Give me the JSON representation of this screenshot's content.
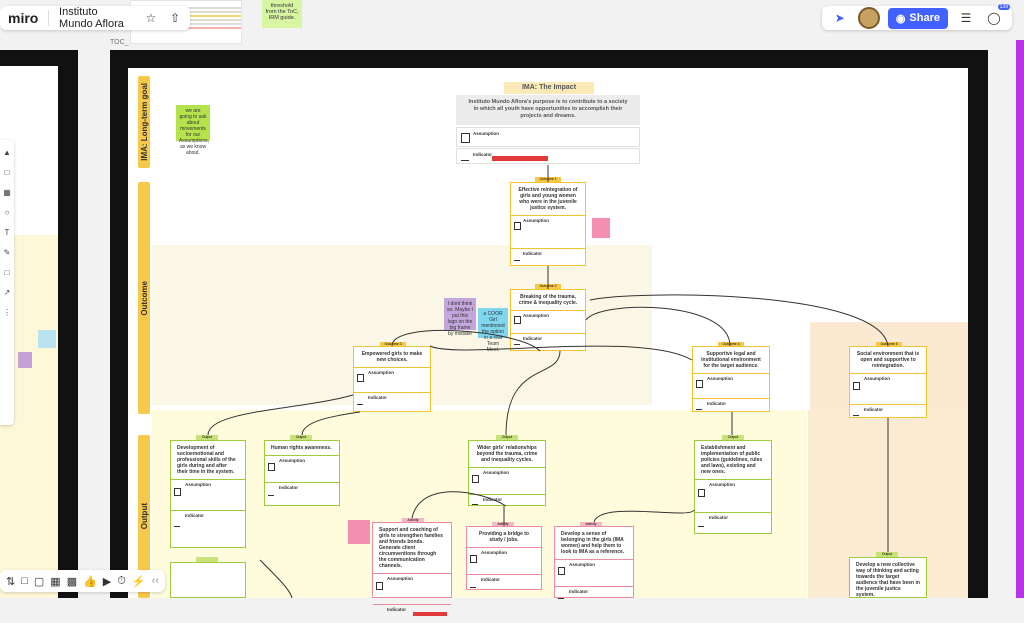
{
  "app": {
    "logo": "miro",
    "board_name": "Instituto Mundo Aflora",
    "share_label": "Share",
    "notification_count": "139"
  },
  "frame_label": "TOC_",
  "top_sticky": {
    "text": "threshold from the ToC, IRM guide."
  },
  "left_band_labels": [
    "IMA: Long-term goal",
    "Outcome",
    "Output"
  ],
  "impact": {
    "header": "IMA: The Impact",
    "statement": "Instituto Mundo Aflora's purpose is to contribute to a society in which all youth have opportunities to accomplish their projects and dreams.",
    "assumption_label": "Assumption",
    "indicator_label": "Indicator"
  },
  "left_sticky": "we are going to ask about movements for our Assumptions, as we know about.",
  "outcome1": {
    "tag": "Outcome 1",
    "title": "Effective reintegration of girls and young women who were in the juvenile justice system."
  },
  "outcome2": {
    "tag": "Outcome 2",
    "title": "Breaking of the trauma, crime & inequality cycle."
  },
  "outcome3": {
    "tag": "Outcome 3",
    "title": "Empowered girls to make new choices."
  },
  "outcome4": {
    "tag": "Outcome 4",
    "title": "Supportive legal and institutional environment for the target audience."
  },
  "outcome5": {
    "tag": "Outcome 5",
    "title": "Social environment that is open and supportive to reintegration."
  },
  "purple_sticky": "I dont think so. Maybe I put this logo on the big frame by mistake",
  "blue_sticky": "a COOR Girl mentioned the option in a real Team Meet.",
  "outputs": [
    {
      "tag": "Output",
      "title": "Development of socioemotional and professional skills of the girls during and after their time in the system."
    },
    {
      "tag": "Output",
      "title": "Human rights awareness."
    },
    {
      "tag": "Output",
      "title": "Wider girls' relationships beyond the trauma, crime and inequality cycles."
    },
    {
      "tag": "Output",
      "title": "Establishment and implementation of public policies (guidelines, rules and laws), existing and new ones."
    },
    {
      "tag": "Output",
      "title": "Develop a new collective way of thinking and acting towards the target audience that have been in the juvenile justice system."
    }
  ],
  "activities": [
    {
      "tag": "Activity",
      "title": "Support and coaching of girls to strengthen families and friends bonds. Generate client circumventions through the communication channels."
    },
    {
      "tag": "Activity",
      "title": "Providing a bridge to study / jobs."
    },
    {
      "tag": "Activity",
      "title": "Develop a sense of belonging in the girls (IMA women) and help them to look to IMA as a reference."
    }
  ],
  "section_labels": {
    "assumption": "Assumption",
    "indicator": "Indicator"
  },
  "colors": {
    "accent": "#4262ff",
    "yellow": "#f7c94a",
    "frame": "#111111",
    "purple_side": "#b832e8"
  }
}
